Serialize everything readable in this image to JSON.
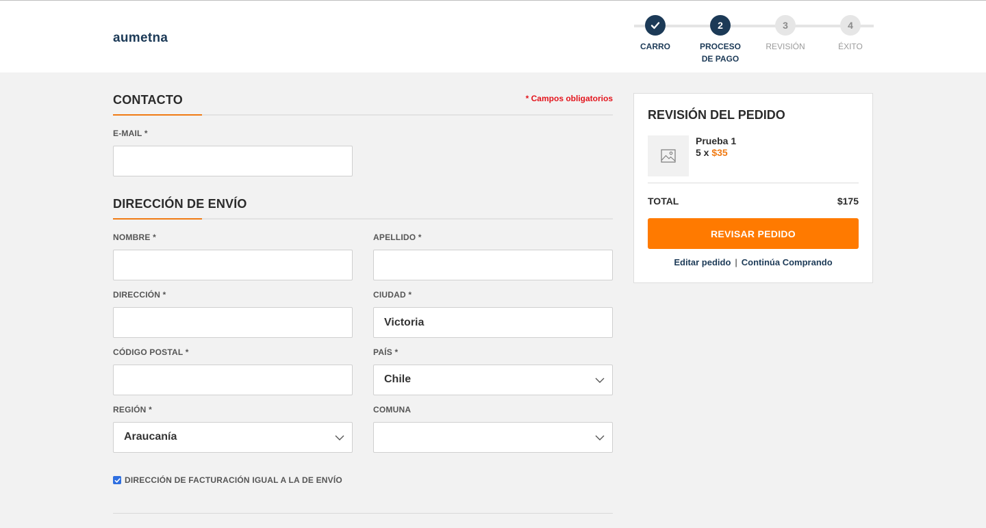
{
  "brand": "aumetna",
  "steps": [
    {
      "number": "✔",
      "label_line1": "CARRO",
      "label_line2": "",
      "state": "done"
    },
    {
      "number": "2",
      "label_line1": "PROCESO",
      "label_line2": "DE PAGO",
      "state": "active"
    },
    {
      "number": "3",
      "label_line1": "REVISIÓN",
      "label_line2": "",
      "state": "pending"
    },
    {
      "number": "4",
      "label_line1": "ÉXITO",
      "label_line2": "",
      "state": "pending"
    }
  ],
  "contact": {
    "title": "CONTACTO",
    "required_note": "* Campos obligatorios",
    "email_label": "E-MAIL *",
    "email_value": ""
  },
  "shipping": {
    "title": "DIRECCIÓN DE ENVÍO",
    "nombre_label": "NOMBRE *",
    "nombre_value": "",
    "apellido_label": "APELLIDO *",
    "apellido_value": "",
    "direccion_label": "DIRECCIÓN *",
    "direccion_value": "",
    "ciudad_label": "CIUDAD *",
    "ciudad_value": "Victoria",
    "postal_label": "CÓDIGO POSTAL *",
    "postal_value": "",
    "pais_label": "PAÍS *",
    "pais_value": "Chile",
    "region_label": "REGIÓN *",
    "region_value": "Araucanía",
    "comuna_label": "COMUNA",
    "comuna_value": ""
  },
  "billing_same": {
    "label": "DIRECCIÓN DE FACTURACIÓN IGUAL A LA DE ENVÍO",
    "checked": true
  },
  "summary": {
    "title": "REVISIÓN DEL PEDIDO",
    "item_name": "Prueba 1",
    "item_qty": "5 x",
    "item_price": "$35",
    "total_label": "TOTAL",
    "total_value": "$175",
    "review_button": "REVISAR PEDIDO",
    "edit_link": "Editar pedido",
    "separator": "|",
    "continue_link": "Continúa Comprando"
  },
  "colors": {
    "accent": "#ff7a00",
    "navy": "#1c3a57",
    "required": "#e3141c",
    "checkbox": "#2f6fe0"
  }
}
